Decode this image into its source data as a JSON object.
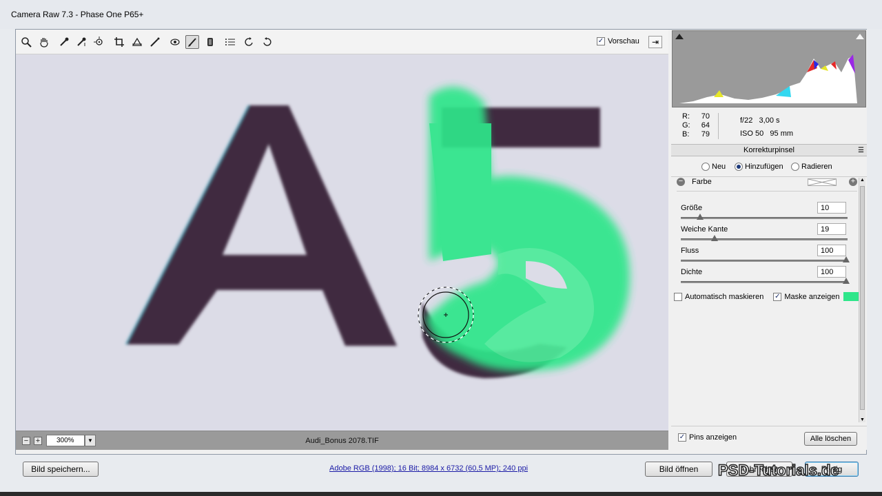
{
  "window": {
    "title": "Camera Raw 7.3 - Phase One P65+"
  },
  "toolbar": {
    "tools": [
      {
        "name": "zoom-tool-icon",
        "glyph": "🔍"
      },
      {
        "name": "hand-tool-icon",
        "glyph": "✋"
      },
      {
        "name": "white-balance-tool-icon",
        "glyph": "⟋"
      },
      {
        "name": "color-sampler-tool-icon",
        "glyph": "⟋"
      },
      {
        "name": "targeted-adjustment-tool-icon",
        "glyph": "⊙"
      },
      {
        "name": "crop-tool-icon",
        "glyph": "⌗"
      },
      {
        "name": "straighten-tool-icon",
        "glyph": "△"
      },
      {
        "name": "spot-removal-tool-icon",
        "glyph": "⟋"
      },
      {
        "name": "red-eye-tool-icon",
        "glyph": "◉"
      },
      {
        "name": "adjustment-brush-tool-icon",
        "glyph": "🖌"
      },
      {
        "name": "graduated-filter-tool-icon",
        "glyph": "▮"
      },
      {
        "name": "preferences-icon",
        "glyph": "☰"
      },
      {
        "name": "rotate-left-icon",
        "glyph": "↺"
      },
      {
        "name": "rotate-right-icon",
        "glyph": "↻"
      }
    ],
    "preview_label": "Vorschau",
    "preview_checked": true
  },
  "canvas": {
    "zoom": "300%",
    "filename": "Audi_Bonus 2078.TIF"
  },
  "info": {
    "r_label": "R:",
    "r_value": "70",
    "g_label": "G:",
    "g_value": "64",
    "b_label": "B:",
    "b_value": "79",
    "aperture": "f/22",
    "shutter": "3,00 s",
    "iso": "ISO 50",
    "focal": "95 mm"
  },
  "panel": {
    "title": "Korrekturpinsel",
    "modes": [
      {
        "label": "Neu",
        "selected": false
      },
      {
        "label": "Hinzufügen",
        "selected": true
      },
      {
        "label": "Radieren",
        "selected": false
      }
    ],
    "farbe_label": "Farbe",
    "sliders": [
      {
        "label": "Größe",
        "value": "10",
        "level": 0.1
      },
      {
        "label": "Weiche Kante",
        "value": "19",
        "level": 0.19
      },
      {
        "label": "Fluss",
        "value": "100",
        "level": 1.0
      },
      {
        "label": "Dichte",
        "value": "100",
        "level": 1.0
      }
    ],
    "auto_mask_label": "Automatisch maskieren",
    "auto_mask_checked": false,
    "show_mask_label": "Maske anzeigen",
    "show_mask_checked": true,
    "mask_color": "#2ee68a",
    "show_pins_label": "Pins anzeigen",
    "show_pins_checked": true,
    "clear_all_label": "Alle löschen"
  },
  "footer": {
    "save_label": "Bild speichern...",
    "workflow_link": "Adobe RGB (1998); 16 Bit; 8984 x 6732 (60,5 MP); 240 ppi",
    "open_label": "Bild öffnen",
    "cancel_label": "Abbrechen",
    "done_label": "Fertig",
    "watermark": "PSD-Tutorials.de"
  },
  "colors": {
    "letter": "#3d2a3e",
    "mask": "#2ee68a",
    "canvas_bg": "#dcdce6"
  }
}
